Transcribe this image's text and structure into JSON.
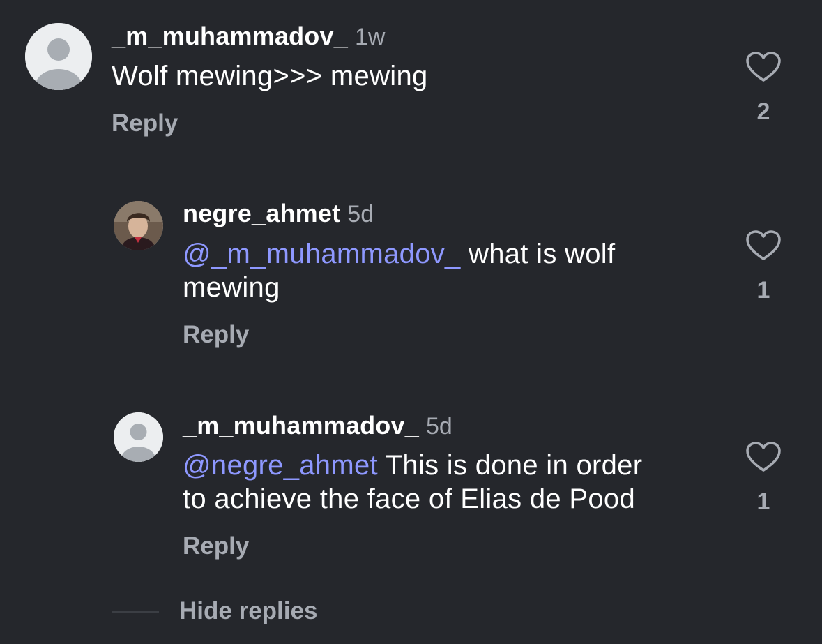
{
  "comments": [
    {
      "username": "_m_muhammadov_",
      "time": "1w",
      "text": "Wolf mewing>>> mewing",
      "reply_label": "Reply",
      "likes": "2",
      "avatar": "default-avatar-icon"
    },
    {
      "username": "negre_ahmet",
      "time": "5d",
      "mention": "@_m_muhammadov_",
      "text_line1": " what is wolf",
      "text_line2": "mewing",
      "reply_label": "Reply",
      "likes": "1",
      "avatar": "profile-photo"
    },
    {
      "username": "_m_muhammadov_",
      "time": "5d",
      "mention": "@negre_ahmet",
      "text_line1": " This is done in order",
      "text_line2": "to achieve the face of Elias de Pood",
      "reply_label": "Reply",
      "likes": "1",
      "avatar": "default-avatar-icon"
    }
  ],
  "hide_replies_label": "Hide replies",
  "colors": {
    "background": "#25272c",
    "mention": "#8e98ff",
    "secondary_text": "#a7abb3"
  }
}
